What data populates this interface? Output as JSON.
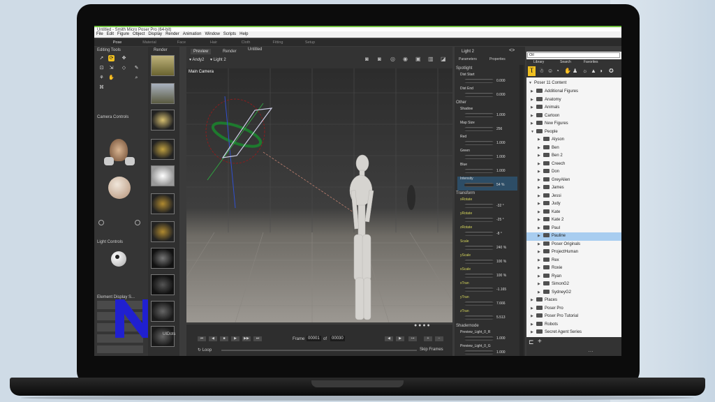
{
  "window": {
    "title": "Untitled - Smith Micro Poser Pro (64-bit)"
  },
  "menu": [
    "File",
    "Edit",
    "Figure",
    "Object",
    "Display",
    "Render",
    "Animation",
    "Window",
    "Scripts",
    "Help"
  ],
  "rooms": [
    "Pose",
    "Material",
    "Face",
    "Hair",
    "Cloth",
    "Fitting",
    "Setup"
  ],
  "left": {
    "editing_tools": "Editing Tools",
    "render_tab": "Render",
    "camera_controls": "Camera Controls",
    "light_controls": "Light Controls",
    "element_display": "Element Display S..."
  },
  "doc": {
    "tab": "Untitled",
    "preview": "Preview",
    "render": "Render",
    "figure": "Andy2",
    "light": "Light 2",
    "camera": "Main Camera"
  },
  "params": {
    "title": "Light 2",
    "tab1": "Parameters",
    "tab2": "Properties",
    "spotlight": "Spotlight",
    "dist_start": {
      "label": "Dist Start",
      "value": "0.000"
    },
    "dist_end": {
      "label": "Dist End",
      "value": "0.000"
    },
    "other": "Other",
    "shadow": {
      "label": "Shadow",
      "value": "1.000"
    },
    "map_size": {
      "label": "Map Size",
      "value": "256"
    },
    "red": {
      "label": "Red",
      "value": "1.000"
    },
    "green": {
      "label": "Green",
      "value": "1.000"
    },
    "blue": {
      "label": "Blue",
      "value": "1.000"
    },
    "intensity": {
      "label": "Intensity",
      "value": "54 %"
    },
    "transform": "Transform",
    "xrotate": {
      "label": "xRotate",
      "value": "-32 °"
    },
    "yrotate": {
      "label": "yRotate",
      "value": "-25 °"
    },
    "zrotate": {
      "label": "zRotate",
      "value": "-8 °"
    },
    "scale": {
      "label": "Scale",
      "value": "240 %"
    },
    "yscale": {
      "label": "yScale",
      "value": "100 %"
    },
    "xscale": {
      "label": "xScale",
      "value": "100 %"
    },
    "xtran": {
      "label": "xTran",
      "value": "-1.165"
    },
    "ytran": {
      "label": "yTran",
      "value": "7.666"
    },
    "ztran": {
      "label": "zTran",
      "value": "5.513"
    },
    "shader": "Shadernode",
    "sn1": {
      "label": "Preview_Light_0_R",
      "value": "1.000"
    },
    "sn2": {
      "label": "Preview_Light_0_G",
      "value": "1.000"
    },
    "sn3": {
      "label": "Preview_Light_0_B",
      "value": "1.000"
    },
    "sn4": {
      "label": "Preview_Light_1",
      "value": "30.000"
    },
    "sn5": {
      "label": "lampFlags_Light_0_R",
      "value": "1.000"
    },
    "sn6": {
      "label": "lampFlags_Light_0_G",
      "value": "1.000"
    },
    "sn7": {
      "label": "lampFlags_Light_0_B",
      "value": "1.000"
    }
  },
  "library": {
    "search": "Oil",
    "tabs": [
      "Library",
      "Search",
      "Favorites"
    ],
    "root": "Poser 11 Content",
    "items": [
      "Additional Figures",
      "Anatomy",
      "Animals",
      "Cartoon",
      "New Figures",
      "People",
      "Alyson",
      "Ben",
      "Ben 2",
      "Creech",
      "Don",
      "GreyAlien",
      "James",
      "Jessi",
      "Judy",
      "Kate",
      "Kate 2",
      "Paul",
      "Pauline",
      "Poser Originals",
      "ProjectHuman",
      "Rex",
      "Roxie",
      "Ryan",
      "SimonG2",
      "SydneyG2",
      "Places",
      "Poser Pro",
      "Poser Pro Tutorial",
      "Robots",
      "Secret Agent Series"
    ]
  },
  "timeline": {
    "frame_label": "Frame",
    "current": "00001",
    "of": "of",
    "total": "00030",
    "loop": "Loop",
    "skip": "Skip Frames",
    "ui_dots": "UIDots"
  },
  "colors": {
    "accent": "#f0c020",
    "logo": "#2020d0",
    "selection": "#a8cdf0"
  }
}
